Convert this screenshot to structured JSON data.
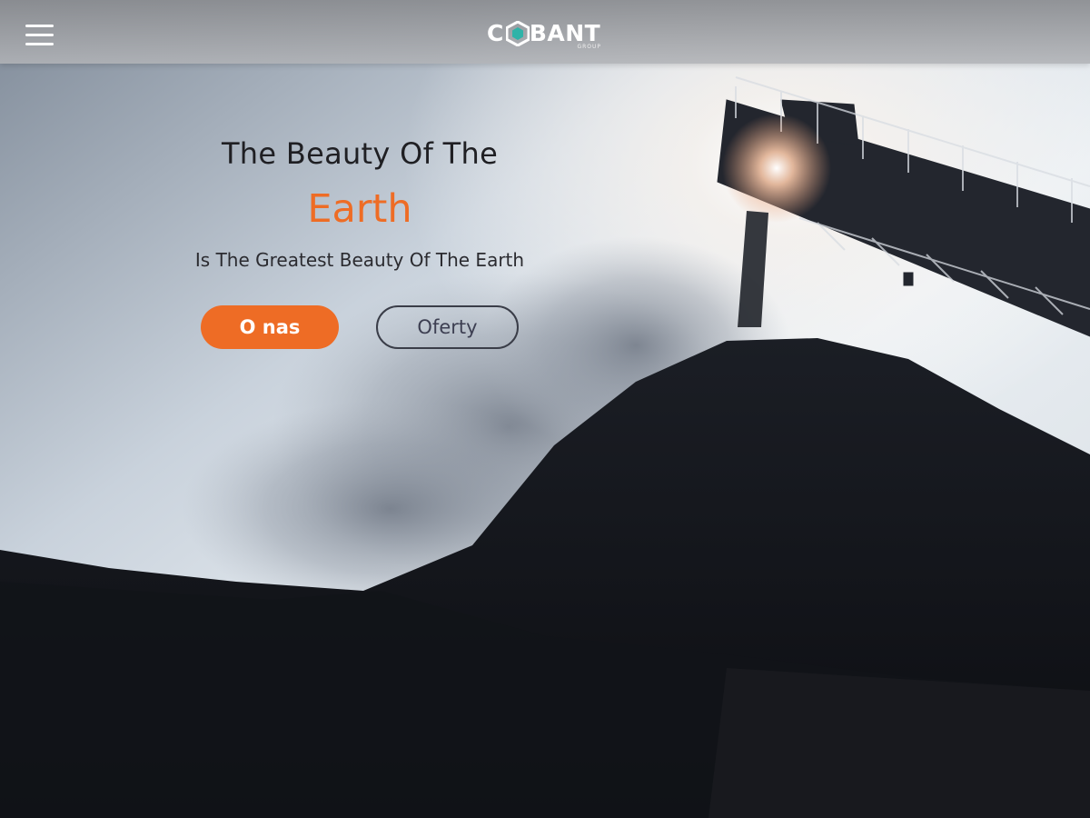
{
  "header": {
    "logo_text": "COBANT",
    "logo_subtext": "GROUP",
    "menu_icon": "hamburger-menu-icon",
    "logo_hex_icon": "hexagon-icon"
  },
  "hero": {
    "headline_line1": "The Beauty Of The",
    "headline_line2": "Earth",
    "subheadline": "Is The Greatest Beauty Of The Earth",
    "primary_button_label": "O nas",
    "secondary_button_label": "Oferty",
    "background_image": "coal-conveyor-stockpile-photo"
  },
  "colors": {
    "accent": "#ee6c25",
    "text_dark": "#1f1f23",
    "header_bg": "#9a9c9f",
    "logo_hex_teal": "#2fb3a8"
  }
}
